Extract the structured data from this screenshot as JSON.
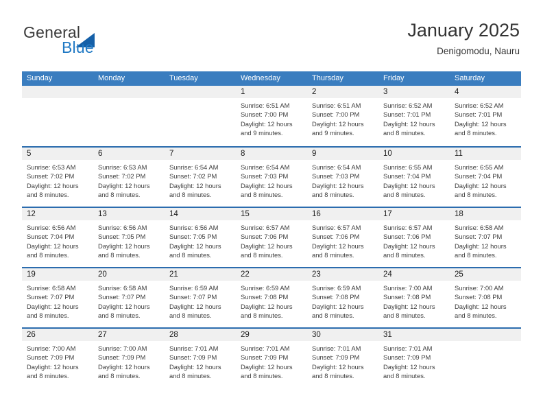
{
  "brand": {
    "word_general": "General",
    "word_blue": "Blue"
  },
  "header": {
    "title": "January 2025",
    "subtitle": "Denigomodu, Nauru"
  },
  "colors": {
    "header_band": "#3a7dbf",
    "week_divider": "#2b6cae",
    "day_number_band": "#f0f0f0",
    "brand_blue": "#2079c4"
  },
  "weekdays": [
    "Sunday",
    "Monday",
    "Tuesday",
    "Wednesday",
    "Thursday",
    "Friday",
    "Saturday"
  ],
  "weeks": [
    [
      {
        "day": "",
        "empty": true,
        "sunrise": "",
        "sunset": "",
        "daylight1": "",
        "daylight2": ""
      },
      {
        "day": "",
        "empty": true,
        "sunrise": "",
        "sunset": "",
        "daylight1": "",
        "daylight2": ""
      },
      {
        "day": "",
        "empty": true,
        "sunrise": "",
        "sunset": "",
        "daylight1": "",
        "daylight2": ""
      },
      {
        "day": "1",
        "sunrise": "Sunrise: 6:51 AM",
        "sunset": "Sunset: 7:00 PM",
        "daylight1": "Daylight: 12 hours",
        "daylight2": "and 9 minutes."
      },
      {
        "day": "2",
        "sunrise": "Sunrise: 6:51 AM",
        "sunset": "Sunset: 7:00 PM",
        "daylight1": "Daylight: 12 hours",
        "daylight2": "and 9 minutes."
      },
      {
        "day": "3",
        "sunrise": "Sunrise: 6:52 AM",
        "sunset": "Sunset: 7:01 PM",
        "daylight1": "Daylight: 12 hours",
        "daylight2": "and 8 minutes."
      },
      {
        "day": "4",
        "sunrise": "Sunrise: 6:52 AM",
        "sunset": "Sunset: 7:01 PM",
        "daylight1": "Daylight: 12 hours",
        "daylight2": "and 8 minutes."
      }
    ],
    [
      {
        "day": "5",
        "sunrise": "Sunrise: 6:53 AM",
        "sunset": "Sunset: 7:02 PM",
        "daylight1": "Daylight: 12 hours",
        "daylight2": "and 8 minutes."
      },
      {
        "day": "6",
        "sunrise": "Sunrise: 6:53 AM",
        "sunset": "Sunset: 7:02 PM",
        "daylight1": "Daylight: 12 hours",
        "daylight2": "and 8 minutes."
      },
      {
        "day": "7",
        "sunrise": "Sunrise: 6:54 AM",
        "sunset": "Sunset: 7:02 PM",
        "daylight1": "Daylight: 12 hours",
        "daylight2": "and 8 minutes."
      },
      {
        "day": "8",
        "sunrise": "Sunrise: 6:54 AM",
        "sunset": "Sunset: 7:03 PM",
        "daylight1": "Daylight: 12 hours",
        "daylight2": "and 8 minutes."
      },
      {
        "day": "9",
        "sunrise": "Sunrise: 6:54 AM",
        "sunset": "Sunset: 7:03 PM",
        "daylight1": "Daylight: 12 hours",
        "daylight2": "and 8 minutes."
      },
      {
        "day": "10",
        "sunrise": "Sunrise: 6:55 AM",
        "sunset": "Sunset: 7:04 PM",
        "daylight1": "Daylight: 12 hours",
        "daylight2": "and 8 minutes."
      },
      {
        "day": "11",
        "sunrise": "Sunrise: 6:55 AM",
        "sunset": "Sunset: 7:04 PM",
        "daylight1": "Daylight: 12 hours",
        "daylight2": "and 8 minutes."
      }
    ],
    [
      {
        "day": "12",
        "sunrise": "Sunrise: 6:56 AM",
        "sunset": "Sunset: 7:04 PM",
        "daylight1": "Daylight: 12 hours",
        "daylight2": "and 8 minutes."
      },
      {
        "day": "13",
        "sunrise": "Sunrise: 6:56 AM",
        "sunset": "Sunset: 7:05 PM",
        "daylight1": "Daylight: 12 hours",
        "daylight2": "and 8 minutes."
      },
      {
        "day": "14",
        "sunrise": "Sunrise: 6:56 AM",
        "sunset": "Sunset: 7:05 PM",
        "daylight1": "Daylight: 12 hours",
        "daylight2": "and 8 minutes."
      },
      {
        "day": "15",
        "sunrise": "Sunrise: 6:57 AM",
        "sunset": "Sunset: 7:06 PM",
        "daylight1": "Daylight: 12 hours",
        "daylight2": "and 8 minutes."
      },
      {
        "day": "16",
        "sunrise": "Sunrise: 6:57 AM",
        "sunset": "Sunset: 7:06 PM",
        "daylight1": "Daylight: 12 hours",
        "daylight2": "and 8 minutes."
      },
      {
        "day": "17",
        "sunrise": "Sunrise: 6:57 AM",
        "sunset": "Sunset: 7:06 PM",
        "daylight1": "Daylight: 12 hours",
        "daylight2": "and 8 minutes."
      },
      {
        "day": "18",
        "sunrise": "Sunrise: 6:58 AM",
        "sunset": "Sunset: 7:07 PM",
        "daylight1": "Daylight: 12 hours",
        "daylight2": "and 8 minutes."
      }
    ],
    [
      {
        "day": "19",
        "sunrise": "Sunrise: 6:58 AM",
        "sunset": "Sunset: 7:07 PM",
        "daylight1": "Daylight: 12 hours",
        "daylight2": "and 8 minutes."
      },
      {
        "day": "20",
        "sunrise": "Sunrise: 6:58 AM",
        "sunset": "Sunset: 7:07 PM",
        "daylight1": "Daylight: 12 hours",
        "daylight2": "and 8 minutes."
      },
      {
        "day": "21",
        "sunrise": "Sunrise: 6:59 AM",
        "sunset": "Sunset: 7:07 PM",
        "daylight1": "Daylight: 12 hours",
        "daylight2": "and 8 minutes."
      },
      {
        "day": "22",
        "sunrise": "Sunrise: 6:59 AM",
        "sunset": "Sunset: 7:08 PM",
        "daylight1": "Daylight: 12 hours",
        "daylight2": "and 8 minutes."
      },
      {
        "day": "23",
        "sunrise": "Sunrise: 6:59 AM",
        "sunset": "Sunset: 7:08 PM",
        "daylight1": "Daylight: 12 hours",
        "daylight2": "and 8 minutes."
      },
      {
        "day": "24",
        "sunrise": "Sunrise: 7:00 AM",
        "sunset": "Sunset: 7:08 PM",
        "daylight1": "Daylight: 12 hours",
        "daylight2": "and 8 minutes."
      },
      {
        "day": "25",
        "sunrise": "Sunrise: 7:00 AM",
        "sunset": "Sunset: 7:08 PM",
        "daylight1": "Daylight: 12 hours",
        "daylight2": "and 8 minutes."
      }
    ],
    [
      {
        "day": "26",
        "sunrise": "Sunrise: 7:00 AM",
        "sunset": "Sunset: 7:09 PM",
        "daylight1": "Daylight: 12 hours",
        "daylight2": "and 8 minutes."
      },
      {
        "day": "27",
        "sunrise": "Sunrise: 7:00 AM",
        "sunset": "Sunset: 7:09 PM",
        "daylight1": "Daylight: 12 hours",
        "daylight2": "and 8 minutes."
      },
      {
        "day": "28",
        "sunrise": "Sunrise: 7:01 AM",
        "sunset": "Sunset: 7:09 PM",
        "daylight1": "Daylight: 12 hours",
        "daylight2": "and 8 minutes."
      },
      {
        "day": "29",
        "sunrise": "Sunrise: 7:01 AM",
        "sunset": "Sunset: 7:09 PM",
        "daylight1": "Daylight: 12 hours",
        "daylight2": "and 8 minutes."
      },
      {
        "day": "30",
        "sunrise": "Sunrise: 7:01 AM",
        "sunset": "Sunset: 7:09 PM",
        "daylight1": "Daylight: 12 hours",
        "daylight2": "and 8 minutes."
      },
      {
        "day": "31",
        "sunrise": "Sunrise: 7:01 AM",
        "sunset": "Sunset: 7:09 PM",
        "daylight1": "Daylight: 12 hours",
        "daylight2": "and 8 minutes."
      },
      {
        "day": "",
        "empty": true,
        "sunrise": "",
        "sunset": "",
        "daylight1": "",
        "daylight2": ""
      }
    ]
  ]
}
